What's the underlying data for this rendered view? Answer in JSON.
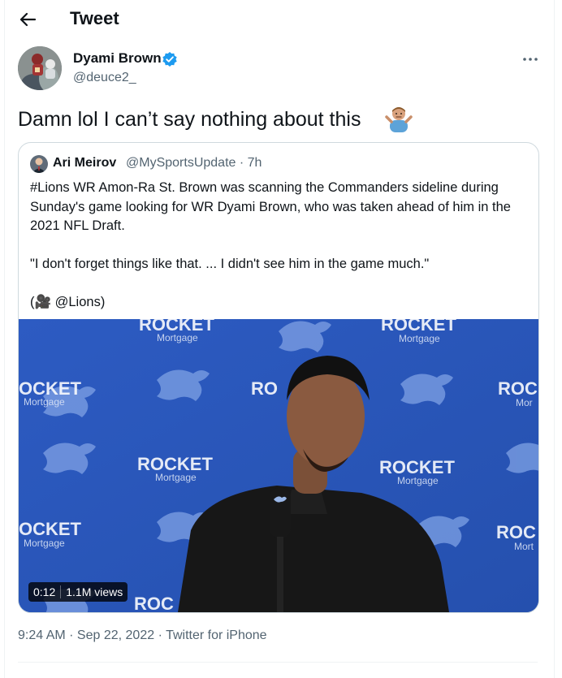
{
  "header": {
    "title": "Tweet",
    "back_icon": "arrow-left-icon"
  },
  "tweet": {
    "author_name": "Dyami Brown",
    "author_handle": "@deuce2_",
    "verified": true,
    "text": "Damn lol I can’t say nothing about this",
    "emoji": "man-shrugging-emoji",
    "timestamp": "9:24 AM · Sep 22, 2022",
    "dot": " · ",
    "source": "Twitter for iPhone"
  },
  "quoted": {
    "author_name": "Ari Meirov",
    "author_handle": "@MySportsUpdate",
    "time": " · 7h",
    "paragraph1": "#Lions WR Amon-Ra St. Brown was scanning the Commanders sideline during Sunday's game looking for WR Dyami Brown, who was taken ahead of him in the 2021 NFL Draft.",
    "paragraph2": "\"I don't forget things like that. ... I didn't see him in the game much.\"",
    "credit_prefix": "(",
    "credit_emoji": "🎥",
    "credit_text": " @Lions)",
    "video": {
      "duration": "0:12",
      "views": "1.1M views",
      "backdrop_brand": "ROCKET",
      "backdrop_sub": "Mortgage"
    }
  },
  "colors": {
    "verified_blue": "#1d9bf0",
    "secondary_text": "#536471",
    "backdrop_blue": "#2b56b8"
  }
}
